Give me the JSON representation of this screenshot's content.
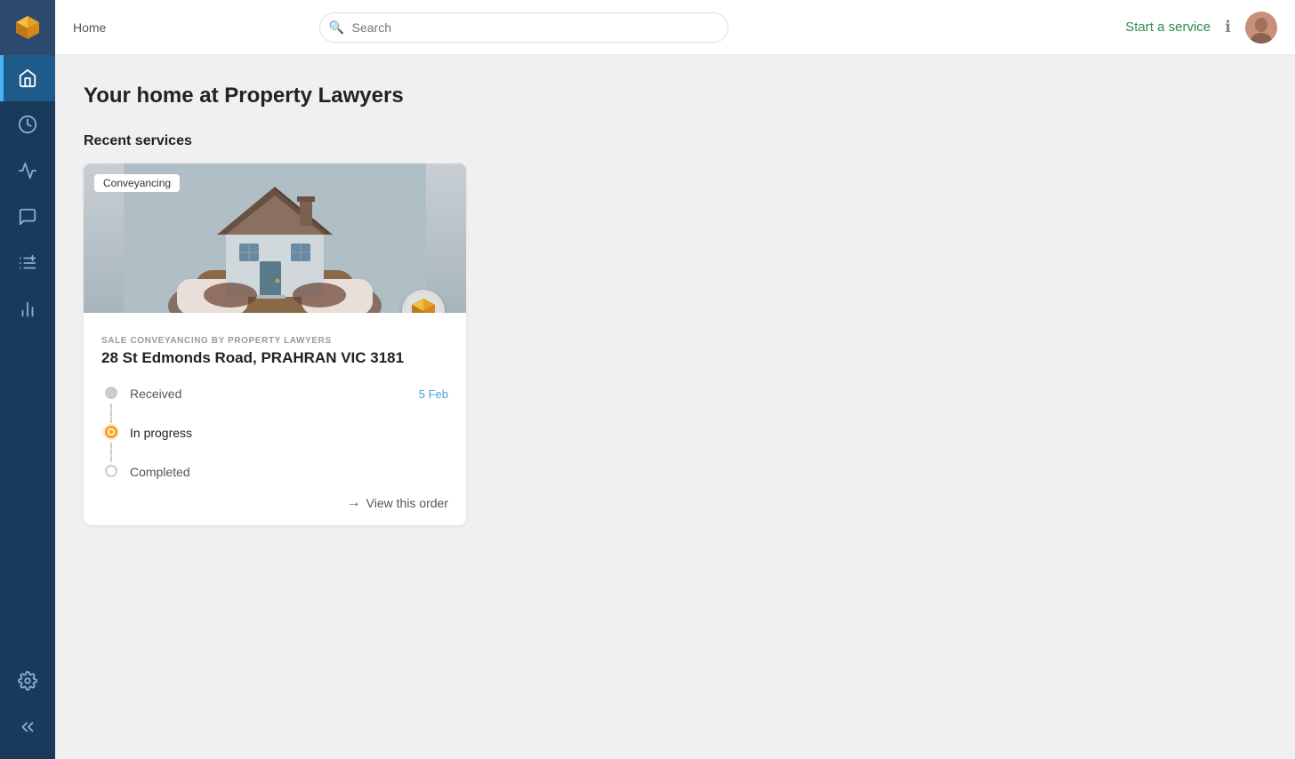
{
  "sidebar": {
    "items": [
      {
        "id": "home",
        "icon": "home-icon",
        "active": true
      },
      {
        "id": "activity",
        "icon": "activity-icon",
        "active": false
      },
      {
        "id": "pulse",
        "icon": "pulse-icon",
        "active": false
      },
      {
        "id": "message",
        "icon": "message-icon",
        "active": false
      },
      {
        "id": "add-list",
        "icon": "add-list-icon",
        "active": false
      },
      {
        "id": "chart",
        "icon": "chart-icon",
        "active": false
      }
    ],
    "bottom_items": [
      {
        "id": "settings",
        "icon": "settings-icon"
      },
      {
        "id": "collapse",
        "icon": "collapse-icon"
      }
    ]
  },
  "topbar": {
    "home_label": "Home",
    "search_placeholder": "Search",
    "start_service_label": "Start a service"
  },
  "page": {
    "title": "Your home at Property Lawyers",
    "recent_services_label": "Recent services"
  },
  "service_card": {
    "badge": "Conveyancing",
    "subtitle": "SALE CONVEYANCING BY PROPERTY LAWYERS",
    "address": "28 St Edmonds Road, PRAHRAN VIC 3181",
    "timeline": [
      {
        "id": "received",
        "label": "Received",
        "date": "5 Feb",
        "status": "received"
      },
      {
        "id": "in-progress",
        "label": "In progress",
        "date": "",
        "status": "in-progress"
      },
      {
        "id": "completed",
        "label": "Completed",
        "date": "",
        "status": "completed"
      }
    ],
    "view_order_label": "View this order"
  }
}
